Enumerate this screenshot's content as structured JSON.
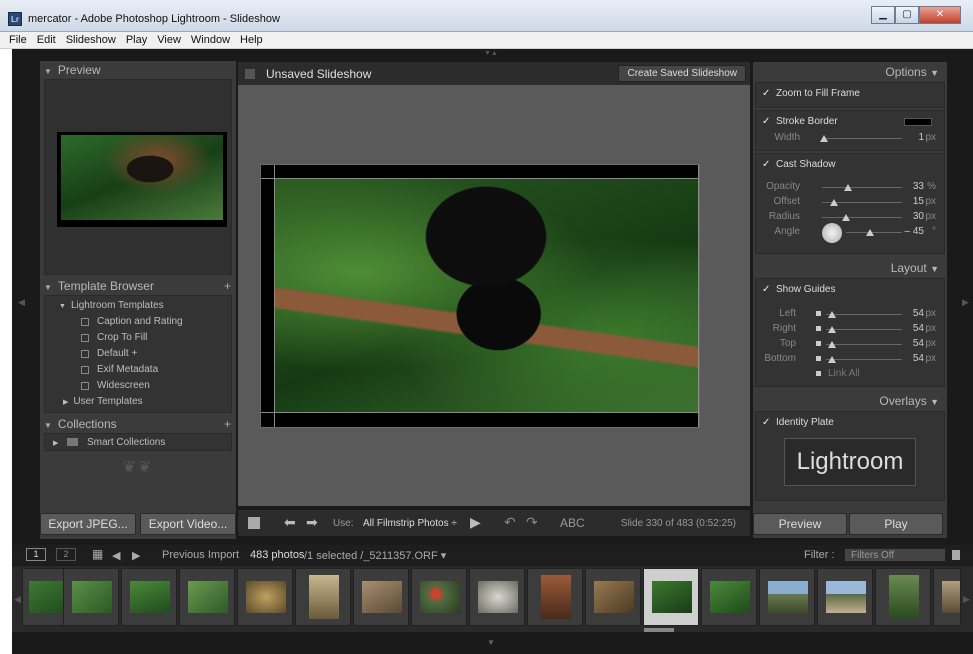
{
  "window": {
    "title": "mercator - Adobe Photoshop Lightroom - Slideshow",
    "app_icon": "Lr"
  },
  "menu": [
    "File",
    "Edit",
    "Slideshow",
    "Play",
    "View",
    "Window",
    "Help"
  ],
  "left": {
    "preview_title": "Preview",
    "template_browser_title": "Template Browser",
    "template_folder": "Lightroom Templates",
    "templates": [
      "Caption and Rating",
      "Crop To Fill",
      "Default +",
      "Exif Metadata",
      "Widescreen"
    ],
    "user_templates": "User Templates",
    "collections_title": "Collections",
    "smart_collections": "Smart Collections",
    "export_jpeg": "Export JPEG...",
    "export_video": "Export Video..."
  },
  "center": {
    "title": "Unsaved Slideshow",
    "create_saved": "Create Saved Slideshow",
    "use_label": "Use:",
    "use_value": "All Filmstrip Photos ÷",
    "abc": "ABC",
    "status": "Slide 330 of 483 (0:52:25)"
  },
  "right": {
    "options_title": "Options",
    "zoom_to_fill": "Zoom to Fill Frame",
    "stroke_border": "Stroke Border",
    "width_label": "Width",
    "width_value": "1",
    "cast_shadow": "Cast Shadow",
    "opacity_label": "Opacity",
    "opacity_value": "33",
    "opacity_pct": 0.33,
    "offset_label": "Offset",
    "offset_value": "15",
    "offset_pct": 0.15,
    "radius_label": "Radius",
    "radius_value": "30",
    "radius_pct": 0.3,
    "angle_label": "Angle",
    "angle_value": "– 45",
    "layout_title": "Layout",
    "show_guides": "Show Guides",
    "left_label": "Left",
    "right_label": "Right",
    "top_label": "Top",
    "bottom_label": "Bottom",
    "margin_value": "54",
    "link_all": "Link All",
    "overlays_title": "Overlays",
    "identity_plate": "Identity Plate",
    "identity_text": "Lightroom",
    "preview_btn": "Preview",
    "play_btn": "Play",
    "px": "px",
    "pct": "%",
    "deg": "°"
  },
  "filmstrip": {
    "page1": "1",
    "page2": "2",
    "source": "Previous Import",
    "count": "483 photos",
    "selection": "/1 selected /_5211357.ORF ▾",
    "filter_label": "Filter :",
    "filter_value": "Filters Off"
  },
  "colors": {
    "panel": "#3b3b3b",
    "canvas": "#5a5a5a",
    "background": "#1a1a1a"
  }
}
